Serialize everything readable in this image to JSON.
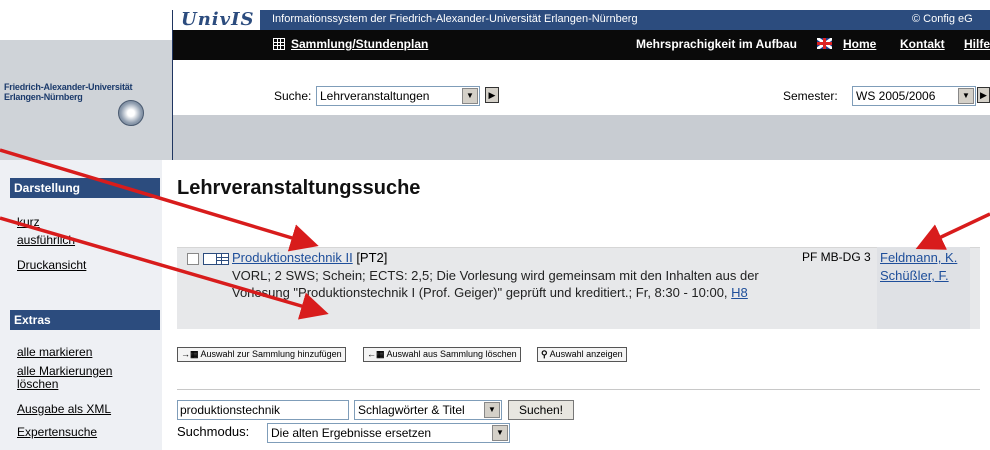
{
  "header": {
    "logo_text": "UnivIS",
    "system_title": "Informationssystem der Friedrich-Alexander-Universität Erlangen-Nürnberg",
    "config_text": "© Config eG",
    "university_name_line1": "Friedrich-Alexander-Universität",
    "university_name_line2": "Erlangen-Nürnberg"
  },
  "nav": {
    "collection_link": "Sammlung/Stundenplan",
    "multilang_text": "Mehrsprachigkeit im Aufbau",
    "home": "Home",
    "contact": "Kontakt",
    "help": "Hilfe"
  },
  "search_bar": {
    "label": "Suche:",
    "selected": "Lehrveranstaltungen",
    "semester_label": "Semester:",
    "semester_selected": "WS 2005/2006"
  },
  "sidebar": {
    "darstellung_title": "Darstellung",
    "darstellung_items": [
      "kurz",
      "ausführlich",
      "Druckansicht"
    ],
    "extras_title": "Extras",
    "extras_items": [
      "alle markieren",
      "alle Markierungen löschen",
      "Ausgabe als XML",
      "Expertensuche"
    ]
  },
  "main": {
    "page_title": "Lehrveranstaltungssuche",
    "result": {
      "title": "Produktionstechnik II",
      "code_tag": "[PT2]",
      "description": "VORL; 2 SWS; Schein; ECTS: 2,5; Die Vorlesung wird gemeinsam mit den Inhalten aus der Vorlesung \"Produktionstechnik I (Prof. Geiger)\" geprüft und kreditiert.; Fr, 8:30 - 10:00,",
      "room": "H8",
      "category": "PF MB-DG 3",
      "lecturers": [
        "Feldmann, K.",
        "Schüßler, F."
      ]
    },
    "actions": {
      "add": "Auswahl zur Sammlung hinzufügen",
      "remove": "Auswahl aus Sammlung löschen",
      "show": "Auswahl anzeigen"
    },
    "query": {
      "value": "produktionstechnik",
      "field_selected": "Schlagwörter & Titel",
      "button": "Suchen!",
      "mode_label": "Suchmodus:",
      "mode_selected": "Die alten Ergebnisse ersetzen"
    }
  },
  "colors": {
    "brand_blue": "#2c4c7e",
    "nav_black": "#0a0a0a",
    "annotation_red": "#d81c1c",
    "link_blue": "#1e4e9a"
  },
  "icons": [
    "grid-icon",
    "flag-uk-icon",
    "arrow-right-icon",
    "dropdown-arrow-icon",
    "checkbox-icon",
    "magnifier-icon"
  ]
}
